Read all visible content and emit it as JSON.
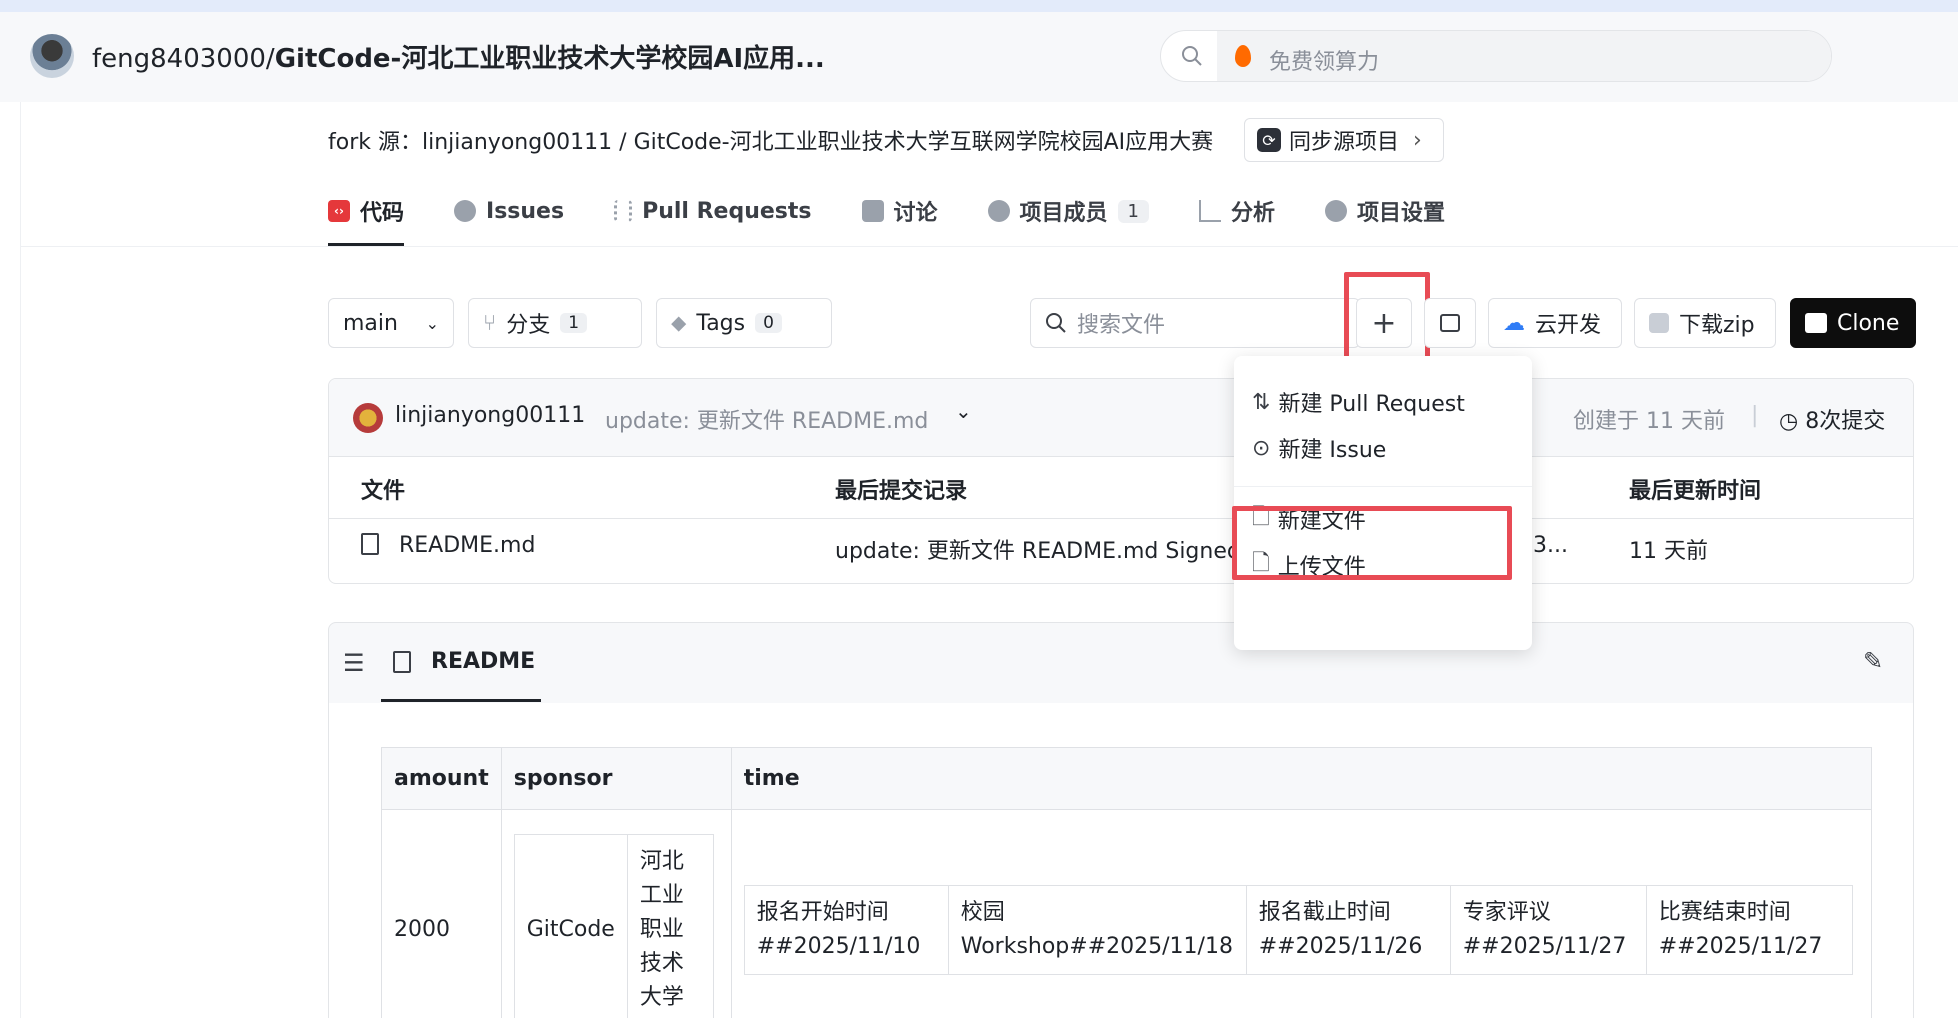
{
  "header": {
    "repo_owner": "feng8403000/",
    "repo_name": "GitCode-河北工业职业技术大学校园AI应用...",
    "search_placeholder": "免费领算力"
  },
  "fork": {
    "text": "fork 源：linjianyong00111 / GitCode-河北工业职业技术大学互联网学院校园AI应用大赛",
    "sync_label": "同步源项目"
  },
  "tabs": [
    {
      "label": "代码",
      "active": true
    },
    {
      "label": "Issues"
    },
    {
      "label": "Pull Requests"
    },
    {
      "label": "讨论"
    },
    {
      "label": "项目成员",
      "count": "1"
    },
    {
      "label": "分析"
    },
    {
      "label": "项目设置"
    }
  ],
  "toolbar": {
    "branch": "main",
    "branches_label": "分支",
    "branches_count": "1",
    "tags_label": "Tags",
    "tags_count": "0",
    "search_placeholder": "搜索文件",
    "plus": "+",
    "cloud_label": "云开发",
    "download_label": "下载zip",
    "clone_label": "Clone"
  },
  "commit": {
    "author": "linjianyong00111",
    "message": "update: 更新文件 README.md",
    "created": "创建于 11 天前",
    "commits": "8次提交"
  },
  "files": {
    "headers": [
      "文件",
      "最后提交记录",
      "最后更新时间"
    ],
    "rows": [
      {
        "name": "README.md",
        "commit": "update: 更新文件 README.md Signed",
        "hash_tail": "3...",
        "time": "11 天前"
      }
    ]
  },
  "dropdown": {
    "items": [
      "新建 Pull Request",
      "新建 Issue",
      "新建文件",
      "上传文件"
    ]
  },
  "readme": {
    "title": "README",
    "headers": [
      "amount",
      "sponsor",
      "time"
    ],
    "amount": "2000",
    "sponsor_name": "GitCode",
    "sponsor_org": "河北\n工业\n职业\n技术\n大学",
    "timeline": [
      {
        "line1": "报名开始时间",
        "line2": "##2025/11/10"
      },
      {
        "line1": "校园",
        "line2": "Workshop##2025/11/18"
      },
      {
        "line1": "报名截止时间",
        "line2": "##2025/11/26"
      },
      {
        "line1": "专家评议",
        "line2": "##2025/11/27"
      },
      {
        "line1": "比赛结束时间",
        "line2": "##2025/11/27"
      }
    ]
  },
  "colors": {
    "highlight": "#e84b55",
    "clone_bg": "#0d0d0d",
    "code_tab_icon": "#e5383b"
  }
}
